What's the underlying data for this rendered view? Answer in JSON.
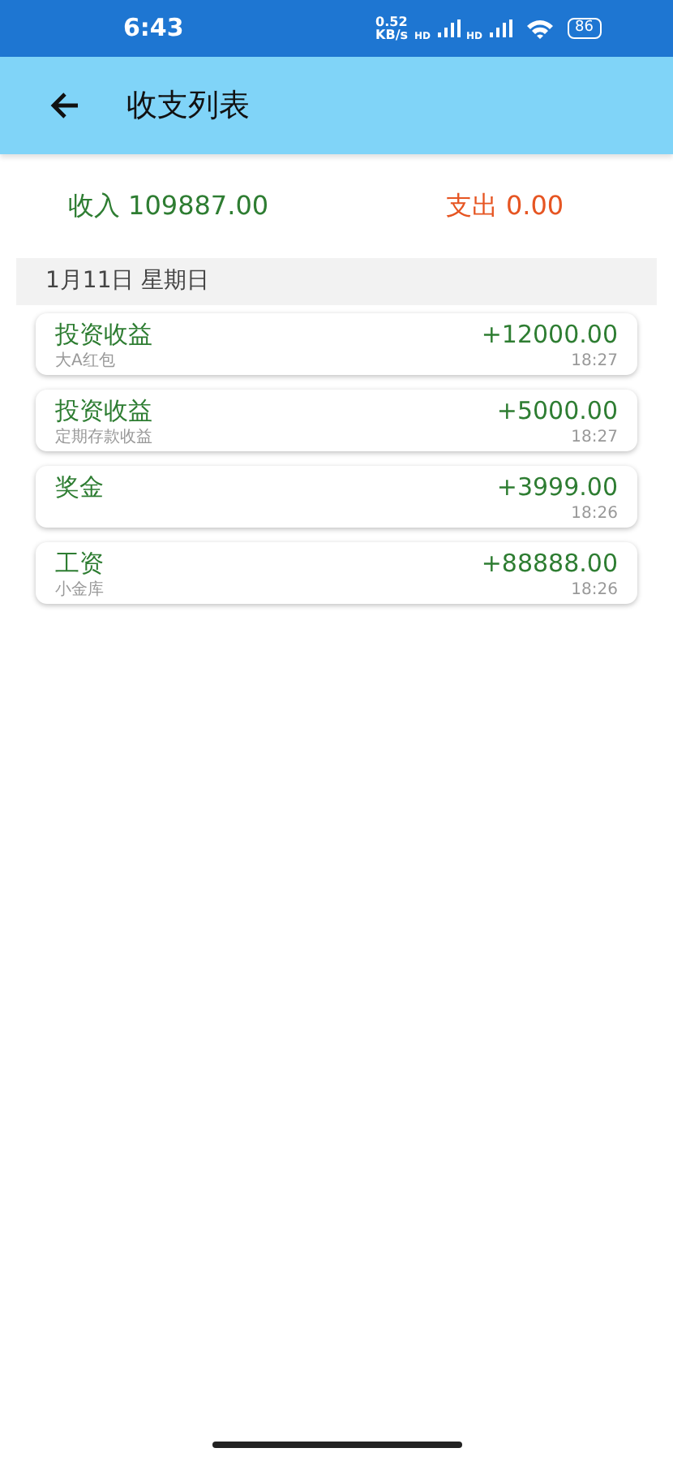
{
  "status_bar": {
    "time": "6:43",
    "net_speed": [
      "0.52",
      "KB/s"
    ],
    "signal_labels": [
      "HD",
      "HD"
    ],
    "battery": "86"
  },
  "app_bar": {
    "title": "收支列表"
  },
  "summary": [
    {
      "kind": "income",
      "text": "收入 109887.00"
    },
    {
      "kind": "expense",
      "text": "支出 0.00"
    }
  ],
  "groups": [
    {
      "date": "1月11日 星期日",
      "items": [
        {
          "kind": "income",
          "category": "投资收益",
          "note": "大A红包",
          "amount": "+12000.00",
          "time": "18:27"
        },
        {
          "kind": "income",
          "category": "投资收益",
          "note": "定期存款收益",
          "amount": "+5000.00",
          "time": "18:27"
        },
        {
          "kind": "income",
          "category": "奖金",
          "amount": "+3999.00",
          "time": "18:26"
        },
        {
          "kind": "income",
          "category": "工资",
          "note": "小金库",
          "amount": "+88888.00",
          "time": "18:26"
        }
      ]
    }
  ]
}
